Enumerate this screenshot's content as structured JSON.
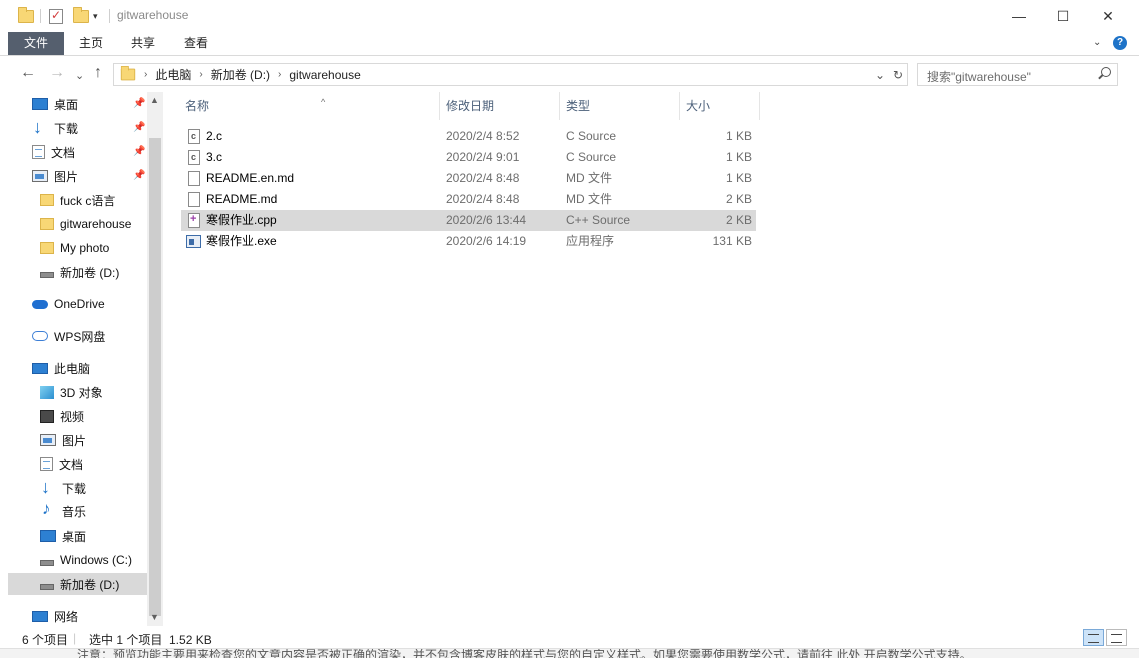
{
  "window": {
    "title": "gitwarehouse",
    "minimize": "—",
    "maximize": "☐",
    "close": "✕"
  },
  "ribbon": {
    "tabs": [
      "文件",
      "主页",
      "共享",
      "查看"
    ],
    "expand": "⌄",
    "help": "?"
  },
  "nav": {
    "back": "←",
    "forward": "→",
    "recent": "⌄",
    "up": "↑",
    "breadcrumb": [
      "此电脑",
      "新加卷 (D:)",
      "gitwarehouse"
    ],
    "crumb_sep": "›",
    "address_dropdown": "⌄",
    "refresh": "↻"
  },
  "search": {
    "placeholder": "搜索\"gitwarehouse\""
  },
  "sidebar": {
    "items": [
      {
        "label": "桌面",
        "icon": "desktop-icon",
        "pinned": true
      },
      {
        "label": "下载",
        "icon": "download-icon",
        "pinned": true
      },
      {
        "label": "文档",
        "icon": "document-icon",
        "pinned": true
      },
      {
        "label": "图片",
        "icon": "picture-icon",
        "pinned": true
      },
      {
        "label": "fuck c语言",
        "icon": "folder-icon"
      },
      {
        "label": "gitwarehouse",
        "icon": "folder-icon"
      },
      {
        "label": "My photo",
        "icon": "folder-icon"
      },
      {
        "label": "新加卷 (D:)",
        "icon": "drive-icon"
      },
      {
        "label": "OneDrive",
        "icon": "onedrive-icon"
      },
      {
        "label": "WPS网盘",
        "icon": "cloud-icon"
      },
      {
        "label": "此电脑",
        "icon": "computer-icon"
      },
      {
        "label": "3D 对象",
        "icon": "3d-objects-icon"
      },
      {
        "label": "视频",
        "icon": "video-icon"
      },
      {
        "label": "图片",
        "icon": "picture-icon"
      },
      {
        "label": "文档",
        "icon": "document-icon"
      },
      {
        "label": "下载",
        "icon": "download-icon"
      },
      {
        "label": "音乐",
        "icon": "music-icon"
      },
      {
        "label": "桌面",
        "icon": "desktop-icon"
      },
      {
        "label": "Windows (C:)",
        "icon": "windows-drive-icon"
      },
      {
        "label": "新加卷 (D:)",
        "icon": "drive-icon",
        "selected": true
      },
      {
        "label": "网络",
        "icon": "network-icon"
      }
    ],
    "pin_glyph": "📌"
  },
  "filelist": {
    "columns": [
      "名称",
      "修改日期",
      "类型",
      "大小"
    ],
    "sort_glyph": "^",
    "rows": [
      {
        "name": "2.c",
        "date": "2020/2/4 8:52",
        "type": "C Source",
        "size": "1 KB",
        "icon": "c-source-file-icon"
      },
      {
        "name": "3.c",
        "date": "2020/2/4 9:01",
        "type": "C Source",
        "size": "1 KB",
        "icon": "c-source-file-icon"
      },
      {
        "name": "README.en.md",
        "date": "2020/2/4 8:48",
        "type": "MD 文件",
        "size": "1 KB",
        "icon": "md-file-icon"
      },
      {
        "name": "README.md",
        "date": "2020/2/4 8:48",
        "type": "MD 文件",
        "size": "2 KB",
        "icon": "md-file-icon"
      },
      {
        "name": "寒假作业.cpp",
        "date": "2020/2/6 13:44",
        "type": "C++ Source",
        "size": "2 KB",
        "icon": "cpp-file-icon",
        "selected": true
      },
      {
        "name": "寒假作业.exe",
        "date": "2020/2/6 14:19",
        "type": "应用程序",
        "size": "131 KB",
        "icon": "exe-file-icon"
      }
    ]
  },
  "status": {
    "count": "6 个项目",
    "selection": "选中 1 个项目  1.52 KB"
  },
  "background_text": "注意：预览功能主要用来检查您的文章内容是否被正确的渲染，并不包含博客皮肤的样式与您的自定义样式。如果您需要使用数学公式，请前往 此处 开启数学公式支持。"
}
